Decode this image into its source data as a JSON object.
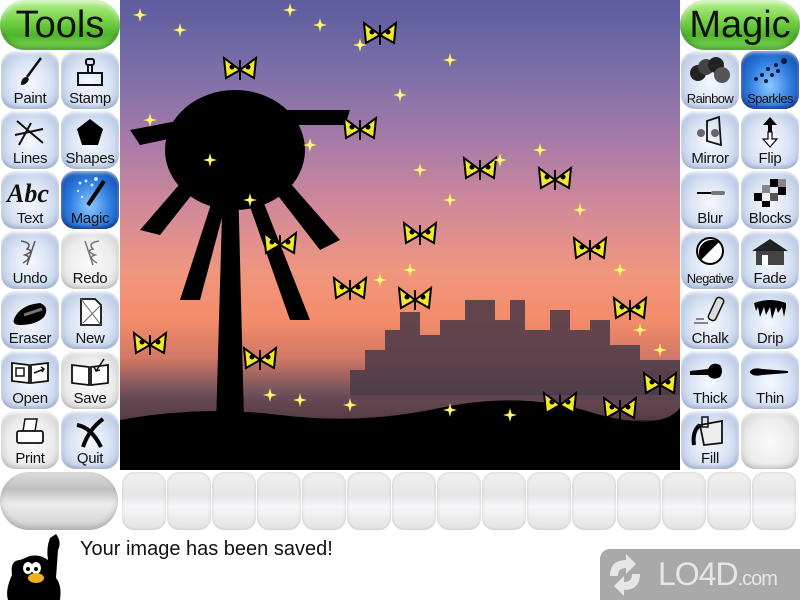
{
  "headers": {
    "tools": "Tools",
    "magic": "Magic"
  },
  "tools": [
    {
      "id": "paint",
      "label": "Paint",
      "icon": "paintbrush-icon",
      "state": "normal"
    },
    {
      "id": "stamp",
      "label": "Stamp",
      "icon": "stamp-icon",
      "state": "normal"
    },
    {
      "id": "lines",
      "label": "Lines",
      "icon": "lines-icon",
      "state": "normal"
    },
    {
      "id": "shapes",
      "label": "Shapes",
      "icon": "pentagon-icon",
      "state": "normal"
    },
    {
      "id": "text",
      "label": "Text",
      "icon": "abc-text-icon",
      "state": "normal"
    },
    {
      "id": "magic",
      "label": "Magic",
      "icon": "magic-wand-icon",
      "state": "selected"
    },
    {
      "id": "undo",
      "label": "Undo",
      "icon": "undo-hand-icon",
      "state": "normal"
    },
    {
      "id": "redo",
      "label": "Redo",
      "icon": "redo-hand-icon",
      "state": "disabled"
    },
    {
      "id": "eraser",
      "label": "Eraser",
      "icon": "eraser-icon",
      "state": "normal"
    },
    {
      "id": "new",
      "label": "New",
      "icon": "new-page-icon",
      "state": "normal"
    },
    {
      "id": "open",
      "label": "Open",
      "icon": "open-book-icon",
      "state": "normal"
    },
    {
      "id": "save",
      "label": "Save",
      "icon": "save-book-icon",
      "state": "disabled"
    },
    {
      "id": "print",
      "label": "Print",
      "icon": "printer-icon",
      "state": "disabled"
    },
    {
      "id": "quit",
      "label": "Quit",
      "icon": "quit-x-icon",
      "state": "normal"
    }
  ],
  "magic": [
    {
      "id": "rainbow",
      "label": "Rainbow",
      "icon": "rainbow-circles-icon",
      "state": "normal"
    },
    {
      "id": "sparkles",
      "label": "Sparkles",
      "icon": "sparkles-icon",
      "state": "selected"
    },
    {
      "id": "mirror",
      "label": "Mirror",
      "icon": "mirror-icon",
      "state": "normal"
    },
    {
      "id": "flip",
      "label": "Flip",
      "icon": "flip-arrow-icon",
      "state": "normal"
    },
    {
      "id": "blur",
      "label": "Blur",
      "icon": "blur-icon",
      "state": "normal"
    },
    {
      "id": "blocks",
      "label": "Blocks",
      "icon": "blocks-icon",
      "state": "normal"
    },
    {
      "id": "negative",
      "label": "Negative",
      "icon": "negative-icon",
      "state": "normal"
    },
    {
      "id": "fade",
      "label": "Fade",
      "icon": "house-fade-icon",
      "state": "normal"
    },
    {
      "id": "chalk",
      "label": "Chalk",
      "icon": "chalk-icon",
      "state": "normal"
    },
    {
      "id": "drip",
      "label": "Drip",
      "icon": "drip-icon",
      "state": "normal"
    },
    {
      "id": "thick",
      "label": "Thick",
      "icon": "thick-brush-icon",
      "state": "normal"
    },
    {
      "id": "thin",
      "label": "Thin",
      "icon": "thin-brush-icon",
      "state": "normal"
    },
    {
      "id": "fill",
      "label": "Fill",
      "icon": "paint-bucket-icon",
      "state": "normal"
    },
    {
      "id": "empty",
      "label": "",
      "icon": "",
      "state": "disabled"
    }
  ],
  "canvas": {
    "description": "Sunset city skyline with palm tree silhouette, yellow butterflies and sparkles"
  },
  "status": {
    "message": "Your image has been saved!"
  },
  "watermark": {
    "text": "LO4D",
    "suffix": ".com"
  },
  "colors": {
    "header_green": "#5ec437",
    "selected_blue": "#2f7de0",
    "button_blue": "#dde6f6"
  }
}
